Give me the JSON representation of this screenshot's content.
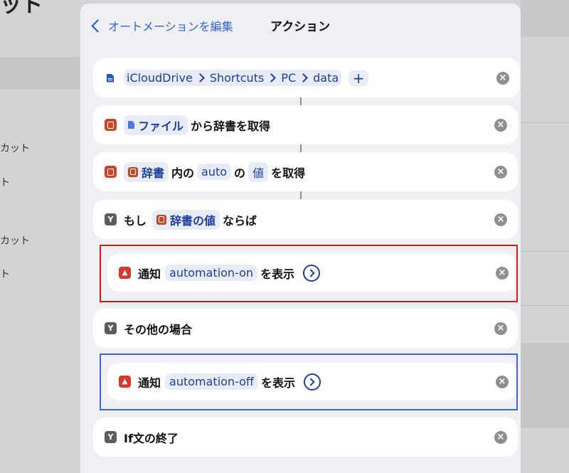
{
  "background": {
    "title_fragment": "ット",
    "items": [
      "カット",
      "ト",
      "カット",
      "ト"
    ]
  },
  "nav": {
    "back_label": "オートメーションを編集",
    "title": "アクション"
  },
  "path_card": {
    "segments": [
      "iCloudDrive",
      "Shortcuts",
      "PC",
      "data"
    ],
    "plus": "+"
  },
  "get_dict_card": {
    "file_token": "ファイル",
    "suffix": "から辞書を取得"
  },
  "get_value_card": {
    "dict_token": "辞書",
    "text_in": "内の",
    "key_token": "auto",
    "text_of": "の",
    "value_token": "値",
    "suffix": "を取得"
  },
  "if_card": {
    "prefix": "もし",
    "var_token": "辞書の値",
    "suffix": "ならば"
  },
  "notify_on_card": {
    "label": "通知",
    "token": "automation-on",
    "suffix": "を表示"
  },
  "otherwise_card": {
    "label": "その他の場合"
  },
  "notify_off_card": {
    "label": "通知",
    "token": "automation-off",
    "suffix": "を表示"
  },
  "end_if_card": {
    "label": "If文の終了"
  },
  "remove_symbol": "×",
  "colors": {
    "accent": "#1d3f9f",
    "link": "#2f65d9",
    "highlight_red": "#e01616",
    "highlight_blue": "#3867df"
  }
}
